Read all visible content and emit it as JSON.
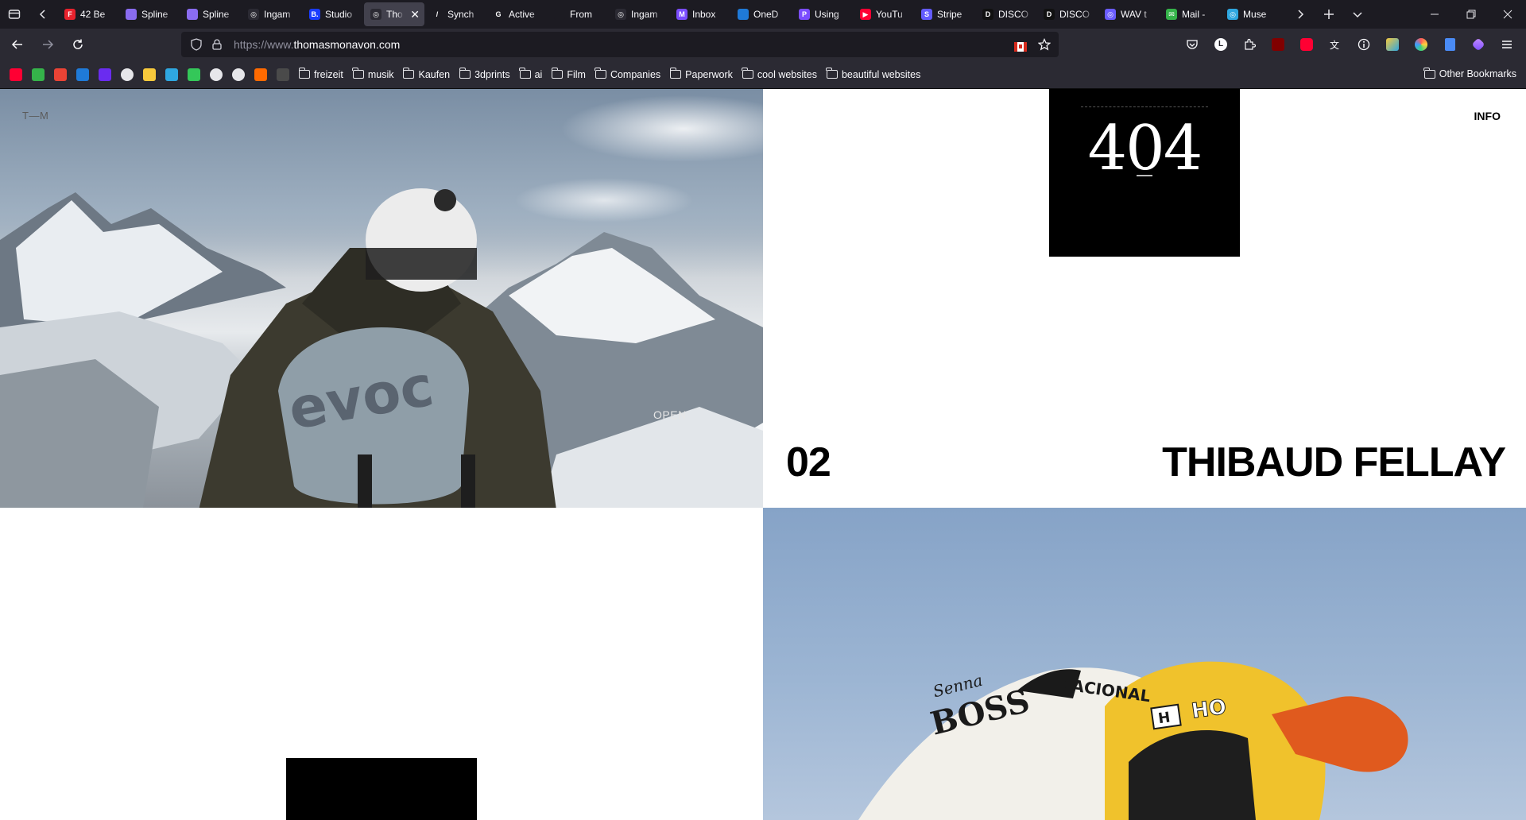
{
  "tabs": [
    {
      "label": "42 Be",
      "fav_color": "#e8222d",
      "fav_glyph": "F"
    },
    {
      "label": "Spline",
      "fav_color": "#8a6cf0",
      "fav_glyph": ""
    },
    {
      "label": "Spline",
      "fav_color": "#8a6cf0",
      "fav_glyph": ""
    },
    {
      "label": "Ingam",
      "fav_color": "#2b2a33",
      "fav_glyph": "◎"
    },
    {
      "label": "Studio",
      "fav_color": "#1a3cff",
      "fav_glyph": "B."
    },
    {
      "label": "Tho",
      "fav_color": "#2b2a33",
      "fav_glyph": "◎",
      "active": true
    },
    {
      "label": "Synch",
      "fav_color": "#1c1b22",
      "fav_glyph": "/"
    },
    {
      "label": "Active",
      "fav_color": "#1c1b22",
      "fav_glyph": "G"
    },
    {
      "label": "From",
      "fav_color": "#1c1b22",
      "fav_glyph": ""
    },
    {
      "label": "Ingam",
      "fav_color": "#2b2a33",
      "fav_glyph": "◎"
    },
    {
      "label": "Inbox",
      "fav_color": "#7b4dff",
      "fav_glyph": "M"
    },
    {
      "label": "OneD",
      "fav_color": "#1f7ad8",
      "fav_glyph": ""
    },
    {
      "label": "Using",
      "fav_color": "#7b4dff",
      "fav_glyph": "P"
    },
    {
      "label": "YouTu",
      "fav_color": "#ff0033",
      "fav_glyph": "▶"
    },
    {
      "label": "Stripe",
      "fav_color": "#635bff",
      "fav_glyph": "S"
    },
    {
      "label": "DISCO",
      "fav_color": "#111111",
      "fav_glyph": "D"
    },
    {
      "label": "DISCO",
      "fav_color": "#111111",
      "fav_glyph": "D"
    },
    {
      "label": "WAV t",
      "fav_color": "#6a5cff",
      "fav_glyph": "◎"
    },
    {
      "label": "Mail -",
      "fav_color": "#35b34a",
      "fav_glyph": "✉"
    },
    {
      "label": "Muse",
      "fav_color": "#2fa7e0",
      "fav_glyph": "◎"
    }
  ],
  "nav": {
    "url_prefix": "https://www.",
    "url_host": "thomasmonavon.com"
  },
  "bookmarks": {
    "icons": [
      "#ff0033",
      "#35b34a",
      "#ea4335",
      "#1f7ad8",
      "#6a2cf0",
      "#e6e6ea",
      "#f7c93c",
      "#2fa7e0",
      "#34c759",
      "#e6e6ea",
      "#e6e6ea",
      "#ff6a00",
      "#4a4a4a"
    ],
    "folders": [
      "freizeit",
      "musik",
      "Kaufen",
      "3dprints",
      "ai",
      "Film",
      "Companies",
      "Paperwork",
      "cool websites",
      "beautiful websites"
    ],
    "other": "Other Bookmarks"
  },
  "site": {
    "logo": "T—M",
    "open": "OPEN",
    "info": "INFO",
    "error_code": "404",
    "project_number": "02",
    "project_name": "THIBAUD FELLAY",
    "sponsor_1": "Senna",
    "sponsor_2": "BOSS",
    "helmet_text": "NACIONAL",
    "helmet_brand": "H",
    "helmet_text_2": "HO"
  }
}
